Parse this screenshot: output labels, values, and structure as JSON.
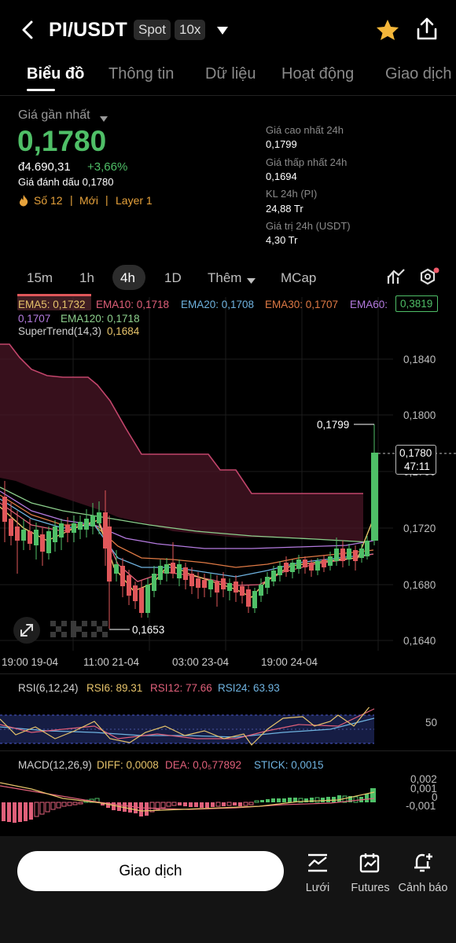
{
  "header": {
    "pair": "PI/USDT",
    "spot_badge": "Spot",
    "leverage_badge": "10x"
  },
  "tabs": [
    "Biểu đồ",
    "Thông tin",
    "Dữ liệu",
    "Hoạt động",
    "Giao dịch"
  ],
  "price": {
    "label": "Giá gần nhất",
    "last": "0,1780",
    "fiat": "đ4.690,31",
    "change": "+3,66%",
    "mark_label": "Giá đánh dấu 0,1780",
    "tags": [
      "Số 12",
      "Mới",
      "Layer 1"
    ]
  },
  "stats": [
    {
      "label": "Giá cao nhất 24h",
      "value": "0,1799"
    },
    {
      "label": "Giá thấp nhất 24h",
      "value": "0,1694"
    },
    {
      "label": "KL 24h (PI)",
      "value": "24,88 Tr"
    },
    {
      "label": "Giá trị 24h (USDT)",
      "value": "4,30 Tr"
    }
  ],
  "timeframes": [
    "15m",
    "1h",
    "4h",
    "1D",
    "Thêm",
    "MCap"
  ],
  "active_timeframe": "4h",
  "ema_legend": {
    "ema5": "EMA5: 0,1732",
    "ema10": "EMA10: 0,1718",
    "ema20": "EMA20: 0,1708",
    "ema30": "EMA30: 0,1707",
    "ema60": "EMA60:",
    "ema60_value": "0,1707",
    "ema120": "EMA120: 0,1718",
    "supertrend": "SuperTrend(14,3)",
    "supertrend_value": "0,1684",
    "badge_value": "0,3819"
  },
  "chart": {
    "y_labels": [
      "0,1840",
      "0,1800",
      "0,1760",
      "0,1720",
      "0,1680",
      "0,1640"
    ],
    "x_labels": [
      "19:00 19-04",
      "11:00 21-04",
      "03:00 23-04",
      "19:00 24-04"
    ],
    "high_label": "0,1799",
    "low_label": "0,1653",
    "current_price": "0,1780",
    "countdown": "47:11"
  },
  "rsi": {
    "title": "RSI(6,12,24)",
    "rsi6": "RSI6: 89.31",
    "rsi12": "RSI12: 77.66",
    "rsi24": "RSI24: 63.93",
    "axis_label": "50"
  },
  "macd": {
    "title": "MACD(12,26,9)",
    "diff": "DIFF: 0,0008",
    "dea": "DEA: 0,0₅77892",
    "stick": "STICK: 0,0015",
    "axis_labels": [
      "0,002",
      "0,001",
      "0",
      "-0,001"
    ]
  },
  "bottom": {
    "trade": "Giao dịch",
    "grid": "Lưới",
    "futures": "Futures",
    "alert": "Cảnh báo"
  }
}
